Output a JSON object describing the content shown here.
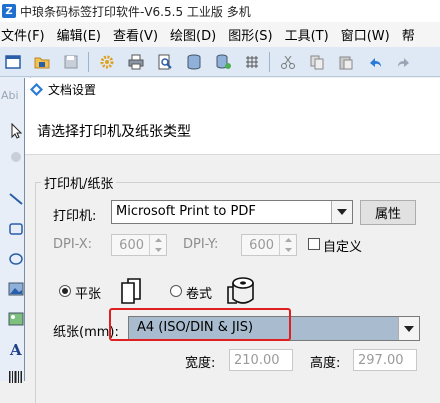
{
  "app": {
    "title": "中琅条码标签打印软件-V6.5.5 工业版 多机"
  },
  "menu": {
    "items": [
      "文件(F)",
      "编辑(E)",
      "查看(V)",
      "绘图(D)",
      "图形(S)",
      "工具(T)",
      "窗口(W)",
      "帮"
    ]
  },
  "toolbar": {
    "icons": [
      "window-icon",
      "open-folder-icon",
      "save-icon",
      "settings-gear-icon",
      "print-icon",
      "print-preview-icon",
      "database-icon",
      "database-connect-icon",
      "grid-icon",
      "cut-icon",
      "copy-icon",
      "paste-icon",
      "undo-icon",
      "redo-icon"
    ]
  },
  "leftstrip": {
    "abc": "Abi"
  },
  "dialog": {
    "title": "文档设置",
    "header": "请选择打印机及纸张类型",
    "group_label": "打印机/纸张",
    "printer_label": "打印机:",
    "printer_value": "Microsoft Print to PDF",
    "properties_button": "属性",
    "dpix_label": "DPI-X:",
    "dpix_value": "600",
    "dpiy_label": "DPI-Y:",
    "dpiy_value": "600",
    "custom_label": "自定义",
    "flat_label": "平张",
    "roll_label": "卷式",
    "paper_label": "纸张(mm):",
    "paper_value": "A4 (ISO/DIN & JIS)",
    "width_label": "宽度:",
    "width_value": "210.00",
    "height_label": "高度:",
    "height_value": "297.00"
  },
  "colors": {
    "highlight": "#e02020",
    "paper_selected_bg": "#a9bccf",
    "toolbar_bg": "#dfe9f5"
  }
}
